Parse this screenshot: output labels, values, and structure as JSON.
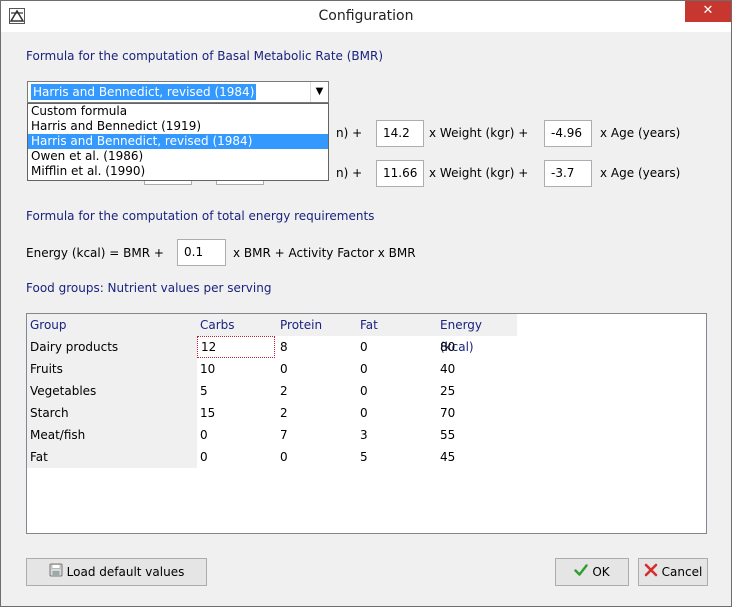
{
  "window": {
    "title": "Configuration",
    "close_glyph": "✕"
  },
  "bmr": {
    "section_title": "Formula for the computation of Basal Metabolic Rate (BMR)",
    "selected_formula": "Harris and Bennedict, revised (1984)",
    "options": [
      "Custom formula",
      "Harris and Bennedict (1919)",
      "Harris and Bennedict, revised (1984)",
      "Owen et al. (1986)",
      "Mifflin et al. (1990)"
    ],
    "row1": {
      "partial_label": "n) +",
      "weight_coef": "14.2",
      "weight_label": "x Weight (kgr) +",
      "age_coef": "-4.96",
      "age_label": "x Age (years)"
    },
    "row2": {
      "partial_label": "n) +",
      "weight_coef": "11.66",
      "weight_label": "x Weight (kgr) +",
      "age_coef": "-3.7",
      "age_label": "x Age (years)"
    }
  },
  "energy": {
    "section_title": "Formula for the computation of total energy requirements",
    "prefix": "Energy (kcal) = BMR +",
    "coef": "0.1",
    "suffix": "x BMR + Activity Factor x BMR"
  },
  "food": {
    "section_title": "Food groups: Nutrient values per serving",
    "headers": [
      "Group",
      "Carbs",
      "Protein",
      "Fat",
      "Energy (kcal)"
    ],
    "rows": [
      [
        "Dairy products",
        "12",
        "8",
        "0",
        "80"
      ],
      [
        "Fruits",
        "10",
        "0",
        "0",
        "40"
      ],
      [
        "Vegetables",
        "5",
        "2",
        "0",
        "25"
      ],
      [
        "Starch",
        "15",
        "2",
        "0",
        "70"
      ],
      [
        "Meat/fish",
        "0",
        "7",
        "3",
        "55"
      ],
      [
        "Fat",
        "0",
        "0",
        "5",
        "45"
      ]
    ]
  },
  "buttons": {
    "load_defaults": "Load default values",
    "ok": "OK",
    "cancel": "Cancel"
  },
  "icons": {
    "app": "app-icon",
    "load": "disk-icon",
    "ok": "checkmark-icon",
    "cancel": "x-icon"
  },
  "colors": {
    "section_title": "#1a237e",
    "selection": "#3399ff",
    "close_button": "#c7372f",
    "ok_check": "#2e9e2e",
    "cancel_x": "#d32f2f"
  }
}
